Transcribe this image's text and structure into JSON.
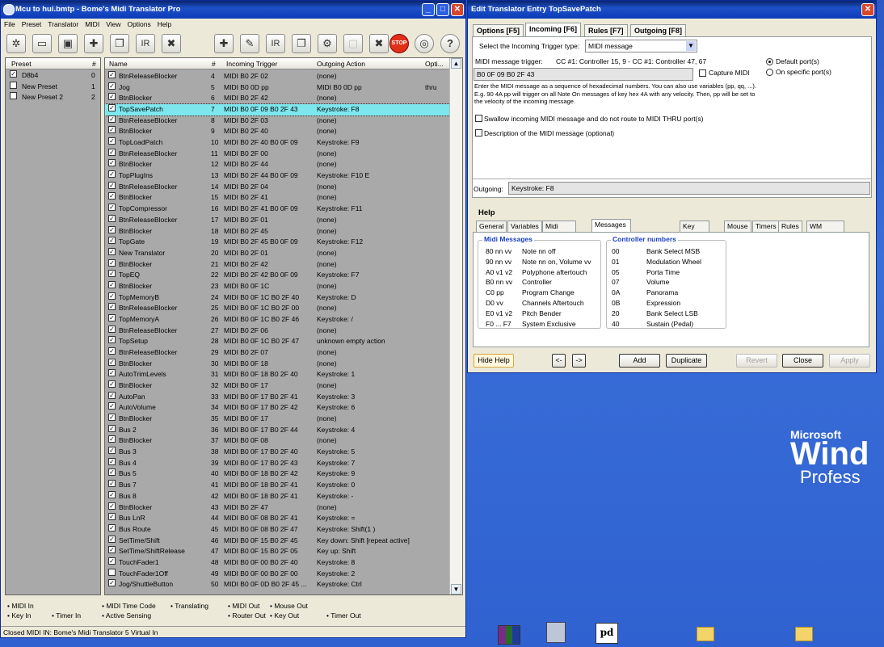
{
  "main_window": {
    "title": "Mcu to hui.bmtp - Bome's Midi Translator Pro",
    "menu": [
      "File",
      "Preset",
      "Translator",
      "MIDI",
      "View",
      "Options",
      "Help"
    ],
    "toolbar_left": [
      "preset-icon",
      "open-icon",
      "save-icon",
      "add-icon",
      "duplicate-icon",
      "rename-icon",
      "delete-icon"
    ],
    "toolbar_right": [
      "add-translator-icon",
      "edit-icon",
      "rename-translator-icon",
      "copy-icon",
      "settings-icon",
      "disabled-icon",
      "delete-translator-icon"
    ],
    "stop_label": "STOP",
    "preset_headers": {
      "name": "Preset",
      "num": "#"
    },
    "presets": [
      {
        "name": "D8b4",
        "num": "0",
        "checked": true
      },
      {
        "name": "New Preset",
        "num": "1",
        "checked": false
      },
      {
        "name": "New Preset 2",
        "num": "2",
        "checked": false
      }
    ],
    "translator_headers": {
      "name": "Name",
      "num": "#",
      "in": "Incoming Trigger",
      "out": "Outgoing Action",
      "opt": "Opti..."
    },
    "translators": [
      {
        "name": "BtnReleaseBlocker",
        "num": "4",
        "in": "MIDI B0 2F 02",
        "out": "(none)",
        "opt": "",
        "checked": true
      },
      {
        "name": "Jog",
        "num": "5",
        "in": "MIDI B0 0D pp",
        "out": "MIDI B0 0D pp",
        "opt": "thru",
        "checked": true
      },
      {
        "name": "BtnBlocker",
        "num": "6",
        "in": "MIDI B0 2F 42",
        "out": "(none)",
        "opt": "",
        "checked": true
      },
      {
        "name": "TopSavePatch",
        "num": "7",
        "in": "MIDI B0 0F 09 B0 2F 43",
        "out": "Keystroke: F8",
        "opt": "",
        "checked": true,
        "selected": true
      },
      {
        "name": "BtnReleaseBlocker",
        "num": "8",
        "in": "MIDI B0 2F 03",
        "out": "(none)",
        "opt": "",
        "checked": true
      },
      {
        "name": "BtnBlocker",
        "num": "9",
        "in": "MIDI B0 2F 40",
        "out": "(none)",
        "opt": "",
        "checked": true
      },
      {
        "name": "TopLoadPatch",
        "num": "10",
        "in": "MIDI B0 2F 40 B0 0F 09",
        "out": "Keystroke: F9",
        "opt": "",
        "checked": true
      },
      {
        "name": "BtnReleaseBlocker",
        "num": "11",
        "in": "MIDI B0 2F 00",
        "out": "(none)",
        "opt": "",
        "checked": true
      },
      {
        "name": "BtnBlocker",
        "num": "12",
        "in": "MIDI B0 2F 44",
        "out": "(none)",
        "opt": "",
        "checked": true
      },
      {
        "name": "TopPlugIns",
        "num": "13",
        "in": "MIDI B0 2F 44 B0 0F 09",
        "out": "Keystroke: F10 E",
        "opt": "",
        "checked": true
      },
      {
        "name": "BtnReleaseBlocker",
        "num": "14",
        "in": "MIDI B0 2F 04",
        "out": "(none)",
        "opt": "",
        "checked": true
      },
      {
        "name": "BtnBlocker",
        "num": "15",
        "in": "MIDI B0 2F 41",
        "out": "(none)",
        "opt": "",
        "checked": true
      },
      {
        "name": "TopCompressor",
        "num": "16",
        "in": "MIDI B0 2F 41 B0 0F 09",
        "out": "Keystroke: F11",
        "opt": "",
        "checked": true
      },
      {
        "name": "BtnReleaseBlocker",
        "num": "17",
        "in": "MIDI B0 2F 01",
        "out": "(none)",
        "opt": "",
        "checked": true
      },
      {
        "name": "BtnBlocker",
        "num": "18",
        "in": "MIDI B0 2F 45",
        "out": "(none)",
        "opt": "",
        "checked": true
      },
      {
        "name": "TopGate",
        "num": "19",
        "in": "MIDI B0 2F 45 B0 0F 09",
        "out": "Keystroke: F12",
        "opt": "",
        "checked": true
      },
      {
        "name": "New Translator",
        "num": "20",
        "in": "MIDI B0 2F 01",
        "out": "(none)",
        "opt": "",
        "checked": true
      },
      {
        "name": "BtnBlocker",
        "num": "21",
        "in": "MIDI B0 2F 42",
        "out": "(none)",
        "opt": "",
        "checked": true
      },
      {
        "name": "TopEQ",
        "num": "22",
        "in": "MIDI B0 2F 42 B0 0F 09",
        "out": "Keystroke: F7",
        "opt": "",
        "checked": true
      },
      {
        "name": "BtnBlocker",
        "num": "23",
        "in": "MIDI B0 0F 1C",
        "out": "(none)",
        "opt": "",
        "checked": true
      },
      {
        "name": "TopMemoryB",
        "num": "24",
        "in": "MIDI B0 0F 1C B0 2F 40",
        "out": "Keystroke: D",
        "opt": "",
        "checked": true
      },
      {
        "name": "BtnReleaseBlocker",
        "num": "25",
        "in": "MIDI B0 0F 1C B0 2F 00",
        "out": "(none)",
        "opt": "",
        "checked": true
      },
      {
        "name": "TopMemoryA",
        "num": "26",
        "in": "MIDI B0 0F 1C B0 2F 46",
        "out": "Keystroke: /",
        "opt": "",
        "checked": true
      },
      {
        "name": "BtnReleaseBlocker",
        "num": "27",
        "in": "MIDI B0 2F 06",
        "out": "(none)",
        "opt": "",
        "checked": true
      },
      {
        "name": "TopSetup",
        "num": "28",
        "in": "MIDI B0 0F 1C B0 2F 47",
        "out": "unknown empty action",
        "opt": "",
        "checked": true
      },
      {
        "name": "BtnReleaseBlocker",
        "num": "29",
        "in": "MIDI B0 2F 07",
        "out": "(none)",
        "opt": "",
        "checked": true
      },
      {
        "name": "BtnBlocker",
        "num": "30",
        "in": "MIDI B0 0F 18",
        "out": "(none)",
        "opt": "",
        "checked": true
      },
      {
        "name": "AutoTrimLevels",
        "num": "31",
        "in": "MIDI B0 0F 18 B0 2F 40",
        "out": "Keystroke: 1",
        "opt": "",
        "checked": true
      },
      {
        "name": "BtnBlocker",
        "num": "32",
        "in": "MIDI B0 0F 17",
        "out": "(none)",
        "opt": "",
        "checked": true
      },
      {
        "name": "AutoPan",
        "num": "33",
        "in": "MIDI B0 0F 17 B0 2F 41",
        "out": "Keystroke: 3",
        "opt": "",
        "checked": true
      },
      {
        "name": "AutoVolume",
        "num": "34",
        "in": "MIDI B0 0F 17 B0 2F 42",
        "out": "Keystroke: 6",
        "opt": "",
        "checked": true
      },
      {
        "name": "BtnBlocker",
        "num": "35",
        "in": "MIDI B0 0F 17",
        "out": "(none)",
        "opt": "",
        "checked": true
      },
      {
        "name": "Bus 2",
        "num": "36",
        "in": "MIDI B0 0F 17 B0 2F 44",
        "out": "Keystroke: 4",
        "opt": "",
        "checked": true
      },
      {
        "name": "BtnBlocker",
        "num": "37",
        "in": "MIDI B0 0F 08",
        "out": "(none)",
        "opt": "",
        "checked": true
      },
      {
        "name": "Bus 3",
        "num": "38",
        "in": "MIDI B0 0F 17 B0 2F 40",
        "out": "Keystroke: 5",
        "opt": "",
        "checked": true
      },
      {
        "name": "Bus 4",
        "num": "39",
        "in": "MIDI B0 0F 17 B0 2F 43",
        "out": "Keystroke: 7",
        "opt": "",
        "checked": true
      },
      {
        "name": "Bus 5",
        "num": "40",
        "in": "MIDI B0 0F 18 B0 2F 42",
        "out": "Keystroke: 9",
        "opt": "",
        "checked": true
      },
      {
        "name": "Bus 7",
        "num": "41",
        "in": "MIDI B0 0F 18 B0 2F 41",
        "out": "Keystroke: 0",
        "opt": "",
        "checked": true
      },
      {
        "name": "Bus 8",
        "num": "42",
        "in": "MIDI B0 0F 18 B0 2F 41",
        "out": "Keystroke: -",
        "opt": "",
        "checked": true
      },
      {
        "name": "BtnBlocker",
        "num": "43",
        "in": "MIDI B0 2F 47",
        "out": "(none)",
        "opt": "",
        "checked": true
      },
      {
        "name": "Bus LnR",
        "num": "44",
        "in": "MIDI B0 0F 08 B0 2F 41",
        "out": "Keystroke: =",
        "opt": "",
        "checked": true
      },
      {
        "name": "Bus Route",
        "num": "45",
        "in": "MIDI B0 0F 08 B0 2F 47",
        "out": "Keystroke: Shift(1 )",
        "opt": "",
        "checked": true
      },
      {
        "name": "SetTime/Shift",
        "num": "46",
        "in": "MIDI B0 0F 15 B0 2F 45",
        "out": "Key down: Shift [repeat active]",
        "opt": "",
        "checked": true
      },
      {
        "name": "SetTime/ShiftRelease",
        "num": "47",
        "in": "MIDI B0 0F 15 B0 2F 05",
        "out": "Key up: Shift",
        "opt": "",
        "checked": true
      },
      {
        "name": "TouchFader1",
        "num": "48",
        "in": "MIDI B0 0F 00 B0 2F 40",
        "out": "Keystroke: 8",
        "opt": "",
        "checked": true
      },
      {
        "name": "TouchFader1Off",
        "num": "49",
        "in": "MIDI B0 0F 00 B0 2F 00",
        "out": "Keystroke: 2",
        "opt": "",
        "checked": false
      },
      {
        "name": "Jog/ShuttleButton",
        "num": "50",
        "in": "MIDI B0 0F 0D B0 2F 45 ...",
        "out": "Keystroke: Ctrl",
        "opt": "",
        "checked": true
      }
    ],
    "legend": {
      "midi_in": "MIDI In",
      "key_in": "Key In",
      "timer_in": "Timer In",
      "midi_time_code": "MIDI Time Code",
      "translating": "Translating",
      "active_sensing": "Active Sensing",
      "midi_out": "MIDI Out",
      "router_out": "Router Out",
      "mouse_out": "Mouse Out",
      "key_out": "Key Out",
      "timer_out": "Timer Out"
    },
    "status": "Closed MIDI IN: Bome's Midi Translator 5 Virtual In"
  },
  "dialog": {
    "title": "Edit Translator Entry TopSavePatch",
    "tabs": [
      {
        "label": "Options [F5]",
        "active": false
      },
      {
        "label": "Incoming [F6]",
        "active": true
      },
      {
        "label": "Rules [F7]",
        "active": false
      },
      {
        "label": "Outgoing [F8]",
        "active": false
      }
    ],
    "trigger_type_label": "Select the Incoming Trigger type:",
    "trigger_type_value": "MIDI message",
    "midi_trigger_label": "MIDI message trigger:",
    "midi_trigger_desc": "CC #1: Controller 15, 9 - CC #1: Controller 47, 67",
    "midi_value": "B0 0F 09 B0 2F 43",
    "capture_label": "Capture MIDI",
    "port_default": "Default port(s)",
    "port_specific": "On specific port(s)",
    "help_text": "Enter the MIDI message as a sequence of hexadecimal numbers. You can also use variables (pp, qq, ...). E.g. 90 4A pp will trigger on all Note On messages of key hex 4A with any velocity. Then, pp will be set to the velocity of the incoming message.",
    "swallow_label": "Swallow incoming MIDI message and do not route to MIDI THRU port(s)",
    "description_label": "Description of the MIDI message (optional)",
    "outgoing_label": "Outgoing:",
    "outgoing_value": "Keystroke: F8",
    "help_title": "Help",
    "help_tabs": [
      {
        "label": "General",
        "active": false
      },
      {
        "label": "Variables",
        "active": false
      },
      {
        "label": "Midi Message",
        "active": false
      },
      {
        "label": "Messages and Controllers",
        "active": true
      },
      {
        "label": "Key Strokes",
        "active": false
      },
      {
        "label": "Mouse",
        "active": false
      },
      {
        "label": "Timers",
        "active": false
      },
      {
        "label": "Rules",
        "active": false
      },
      {
        "label": "WM Messages",
        "active": false
      }
    ],
    "midi_messages_title": "Midi Messages",
    "midi_messages": [
      {
        "code": "80 nn vv",
        "desc": "Note nn off"
      },
      {
        "code": "90 nn vv",
        "desc": "Note nn on, Volume vv"
      },
      {
        "code": "A0 v1 v2",
        "desc": "Polyphone aftertouch"
      },
      {
        "code": "B0 nn vv",
        "desc": "Controller"
      },
      {
        "code": "C0 pp",
        "desc": "Program Change"
      },
      {
        "code": "D0 vv",
        "desc": "Channels Aftertouch"
      },
      {
        "code": "E0 v1 v2",
        "desc": "Pitch Bender"
      },
      {
        "code": "F0 ... F7",
        "desc": "System Exclusive"
      }
    ],
    "controllers_title": "Controller numbers",
    "controllers": [
      {
        "code": "00",
        "desc": "Bank Select MSB"
      },
      {
        "code": "01",
        "desc": "Modulation Wheel"
      },
      {
        "code": "05",
        "desc": "Porta Time"
      },
      {
        "code": "07",
        "desc": "Volume"
      },
      {
        "code": "0A",
        "desc": "Panorama"
      },
      {
        "code": "0B",
        "desc": "Expression"
      },
      {
        "code": "20",
        "desc": "Bank Select LSB"
      },
      {
        "code": "40",
        "desc": "Sustain (Pedal)"
      }
    ],
    "buttons": {
      "hide_help": "Hide Help",
      "prev": "<-",
      "next": "->",
      "add": "Add",
      "duplicate": "Duplicate",
      "revert": "Revert",
      "close": "Close",
      "apply": "Apply"
    }
  },
  "desktop": {
    "logo_line1": "Microsoft",
    "logo_line2": "Wind",
    "logo_line3": "Profess",
    "taskbar_icons": [
      "winrar-icon",
      "usb-icon",
      "pd-icon",
      "folder-icon",
      "folder-icon"
    ],
    "pd_label": "pd"
  }
}
